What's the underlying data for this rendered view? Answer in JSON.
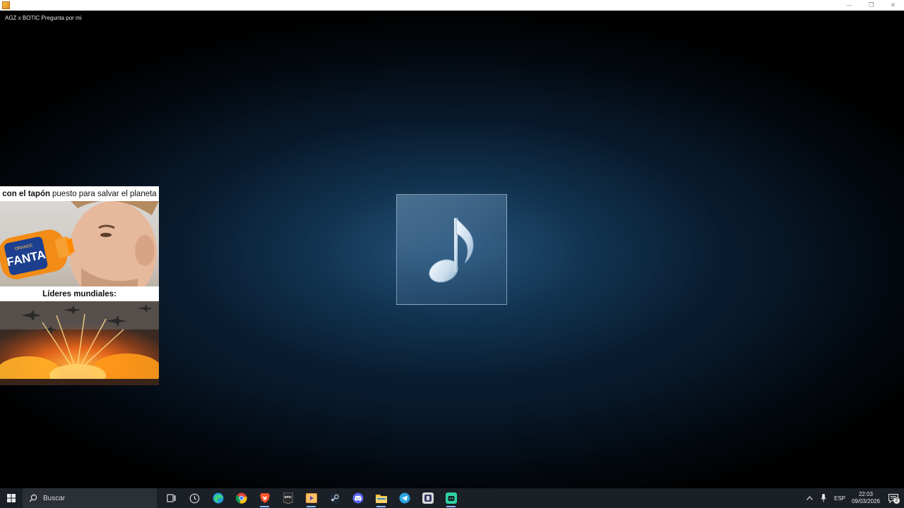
{
  "window": {
    "title": "AGZ x BOTIC Pregunta por mi",
    "controls": {
      "minimize_glyph": "—",
      "restore_glyph": "❐",
      "close_glyph": "✕"
    }
  },
  "player": {
    "album_art_icon": "music-note-icon"
  },
  "meme": {
    "caption_top_bold": "con el tapón",
    "caption_top_rest": "puesto para salvar el planeta",
    "bottle_label": "FANTA",
    "bottle_sublabel": "ORANGE",
    "caption_mid": "Líderes mundiales:"
  },
  "taskbar": {
    "search_placeholder": "Buscar",
    "apps": [
      {
        "name": "task-view",
        "icon": "task-view-icon"
      },
      {
        "name": "widgets",
        "icon": "clock-widget-icon"
      },
      {
        "name": "edge",
        "icon": "edge-icon"
      },
      {
        "name": "chrome",
        "icon": "chrome-icon"
      },
      {
        "name": "brave",
        "icon": "brave-icon"
      },
      {
        "name": "epic-games",
        "icon": "epic-games-icon",
        "label": "EPIC"
      },
      {
        "name": "media-player",
        "icon": "media-player-icon"
      },
      {
        "name": "steam",
        "icon": "steam-icon"
      },
      {
        "name": "discord",
        "icon": "discord-icon"
      },
      {
        "name": "file-explorer",
        "icon": "folder-icon"
      },
      {
        "name": "telegram",
        "icon": "telegram-icon"
      },
      {
        "name": "streamlabs",
        "icon": "streamlabs-icon"
      },
      {
        "name": "app-green",
        "icon": "green-app-icon"
      }
    ],
    "tray": {
      "language": "ESP",
      "time": "22:03",
      "date": "09/03/2026",
      "notification_count": "2"
    }
  },
  "colors": {
    "taskbar_bg": "#1b1f26",
    "accent": "#7fb8ff"
  }
}
